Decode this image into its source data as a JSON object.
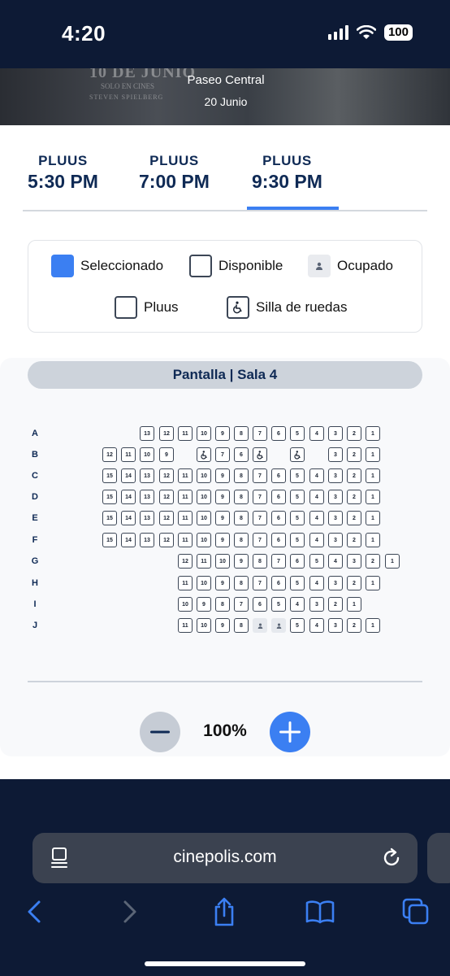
{
  "status_bar": {
    "time": "4:20",
    "battery": "100"
  },
  "hero": {
    "cinema": "Paseo Central",
    "date": "20 Junio",
    "poster_title": "10 DE JUNIO",
    "poster_subtitle": "SOLO EN CINES",
    "poster_credits": "STEVEN SPIELBERG"
  },
  "showtimes": [
    {
      "format": "PLUUS",
      "time": "5:30 PM",
      "active": false
    },
    {
      "format": "PLUUS",
      "time": "7:00 PM",
      "active": false
    },
    {
      "format": "PLUUS",
      "time": "9:30 PM",
      "active": true
    }
  ],
  "legend": {
    "selected": "Seleccionado",
    "available": "Disponible",
    "occupied": "Ocupado",
    "pluus": "Pluus",
    "wheelchair": "Silla de ruedas"
  },
  "screen_label": "Pantalla | Sala 4",
  "seat_map": {
    "rows": [
      {
        "letter": "A",
        "seats": [
          "13",
          "12",
          "11",
          "10",
          "9",
          "8",
          "7",
          "6",
          "5",
          "4",
          "3",
          "2",
          "1"
        ]
      },
      {
        "letter": "B",
        "seats": [
          "12",
          "11",
          "10",
          "9",
          "wc",
          "7",
          "6",
          "wc",
          "wc",
          "3",
          "2",
          "1"
        ]
      },
      {
        "letter": "C",
        "seats": [
          "15",
          "14",
          "13",
          "12",
          "11",
          "10",
          "9",
          "8",
          "7",
          "6",
          "5",
          "4",
          "3",
          "2",
          "1"
        ]
      },
      {
        "letter": "D",
        "seats": [
          "15",
          "14",
          "13",
          "12",
          "11",
          "10",
          "9",
          "8",
          "7",
          "6",
          "5",
          "4",
          "3",
          "2",
          "1"
        ]
      },
      {
        "letter": "E",
        "seats": [
          "15",
          "14",
          "13",
          "12",
          "11",
          "10",
          "9",
          "8",
          "7",
          "6",
          "5",
          "4",
          "3",
          "2",
          "1"
        ]
      },
      {
        "letter": "F",
        "seats": [
          "15",
          "14",
          "13",
          "12",
          "11",
          "10",
          "9",
          "8",
          "7",
          "6",
          "5",
          "4",
          "3",
          "2",
          "1"
        ]
      },
      {
        "letter": "G",
        "seats": [
          "12",
          "11",
          "10",
          "9",
          "8",
          "7",
          "6",
          "5",
          "4",
          "3",
          "2",
          "1"
        ]
      },
      {
        "letter": "H",
        "seats": [
          "11",
          "10",
          "9",
          "8",
          "7",
          "6",
          "5",
          "4",
          "3",
          "2",
          "1"
        ]
      },
      {
        "letter": "I",
        "seats": [
          "10",
          "9",
          "8",
          "7",
          "6",
          "5",
          "4",
          "3",
          "2",
          "1"
        ]
      },
      {
        "letter": "J",
        "seats": [
          "11",
          "10",
          "9",
          "8",
          "occ",
          "occ",
          "5",
          "4",
          "3",
          "2",
          "1"
        ]
      }
    ]
  },
  "zoom": {
    "level": "100%"
  },
  "browser": {
    "url": "cinepolis.com"
  },
  "colors": {
    "accent": "#3b7ff2",
    "navy": "#0f2a55",
    "dark_bg": "#0d1a35"
  }
}
